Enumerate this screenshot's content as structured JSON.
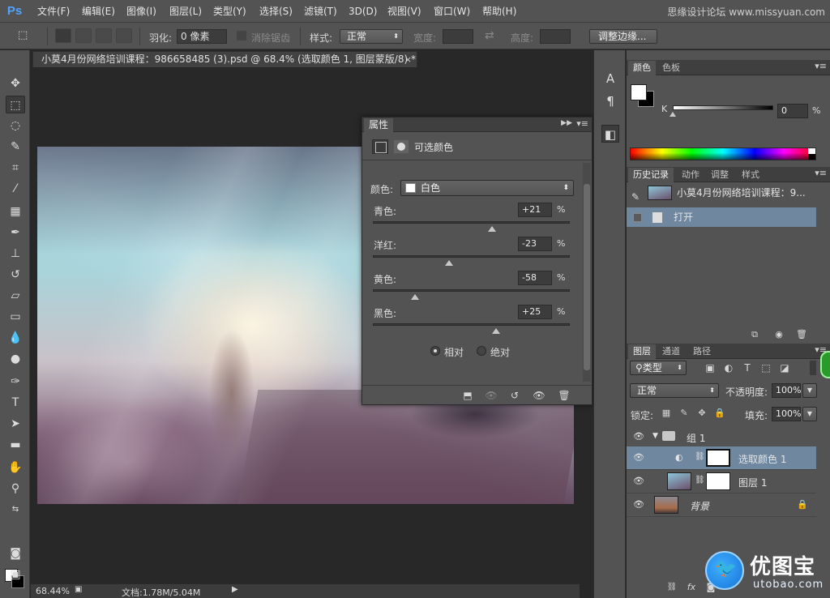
{
  "app": {
    "logo": "Ps",
    "menu": [
      "文件(F)",
      "编辑(E)",
      "图像(I)",
      "图层(L)",
      "类型(Y)",
      "选择(S)",
      "滤镜(T)",
      "3D(D)",
      "视图(V)",
      "窗口(W)",
      "帮助(H)"
    ],
    "watermark_top": "思缘设计论坛 www.missyuan.com"
  },
  "options_bar": {
    "feather_label": "羽化:",
    "feather_value": "0 像素",
    "antialias_label": "消除锯齿",
    "style_label": "样式:",
    "style_value": "正常",
    "width_label": "宽度:",
    "height_label": "高度:",
    "refine_edge_button": "调整边缘..."
  },
  "document": {
    "tab_title": "小莫4月份网络培训课程：986658485 (3).psd @ 68.4% (选取颜色 1, 图层蒙版/8) *",
    "close": "×"
  },
  "status_bar": {
    "zoom": "68.44%",
    "doc_info": "文档:1.78M/5.04M",
    "arrow": "▶"
  },
  "properties": {
    "tab": "属性",
    "title": "可选颜色",
    "colors_label": "颜色:",
    "colors_value": "白色",
    "sliders": [
      {
        "label": "青色:",
        "value": "+21",
        "level": 0.605
      },
      {
        "label": "洋红:",
        "value": "-23",
        "level": 0.385
      },
      {
        "label": "黄色:",
        "value": "-58",
        "level": 0.21
      },
      {
        "label": "黑色:",
        "value": "+25",
        "level": 0.625
      }
    ],
    "percent": "%",
    "method_relative": "相对",
    "method_absolute": "绝对",
    "method_selected": "relative"
  },
  "color_panel": {
    "tabs": [
      "颜色",
      "色板"
    ],
    "channel_label": "K",
    "channel_value": "0",
    "percent": "%"
  },
  "history_panel": {
    "tabs": [
      "历史记录",
      "动作",
      "调整",
      "样式"
    ],
    "snapshot_name": "小莫4月份网络培训课程：9...",
    "items": [
      {
        "label": "打开",
        "selected": true
      }
    ]
  },
  "layers_panel": {
    "tabs": [
      "图层",
      "通道",
      "路径"
    ],
    "filter_kind": "类型",
    "blend_mode": "正常",
    "opacity_label": "不透明度:",
    "opacity_value": "100%",
    "lock_label": "锁定:",
    "fill_label": "填充:",
    "fill_value": "100%",
    "layers": [
      {
        "name": "组 1",
        "type": "group"
      },
      {
        "name": "选取颜色 1",
        "type": "adjustment",
        "selected": true
      },
      {
        "name": "图层 1",
        "type": "pixel"
      },
      {
        "name": "背景",
        "type": "background",
        "locked": true
      }
    ]
  },
  "watermark": {
    "title": "优图宝",
    "subtitle": "utobao.com"
  }
}
